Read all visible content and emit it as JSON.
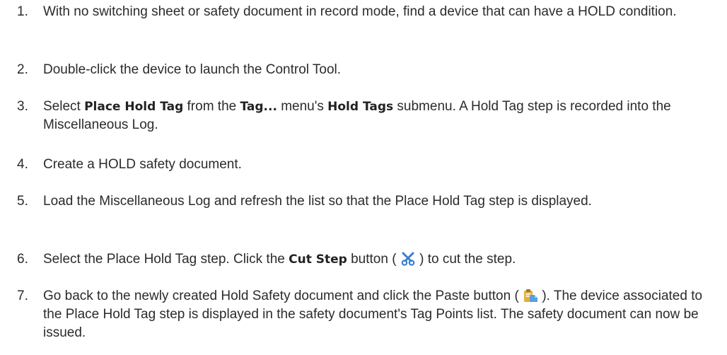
{
  "steps": [
    {
      "number": "1.",
      "text": "With no switching sheet or safety document in record mode, find a device that can have a HOLD condition."
    },
    {
      "number": "2.",
      "text": "Double-click the device to launch the Control Tool."
    },
    {
      "number": "3.",
      "pre": "Select ",
      "ui1": "Place Hold Tag",
      "mid1": " from the ",
      "ui2": "Tag...",
      "mid2": " menu's ",
      "ui3": "Hold Tags",
      "post": " submenu. A Hold Tag step is recorded into the Miscellaneous Log."
    },
    {
      "number": "4.",
      "text": "Create a HOLD safety document."
    },
    {
      "number": "5.",
      "text": "Load the Miscellaneous Log and refresh the list so that the Place Hold Tag step is displayed."
    },
    {
      "number": "6.",
      "pre": "Select the Place Hold Tag step. Click the ",
      "ui1": "Cut Step",
      "mid1": " button ( ",
      "icon": "scissors-icon",
      "post": " ) to cut the step."
    },
    {
      "number": "7.",
      "pre": "Go back to the newly created Hold Safety document and click the Paste button ( ",
      "icon": "paste-icon",
      "post": " ). The device associated to the Place Hold Tag step is displayed in the safety document's Tag Points list. The safety document can now be issued."
    }
  ],
  "colors": {
    "text": "#2b2b2b",
    "scissors": "#3a7fd0",
    "paste_clipboard": "#e2b13c",
    "paste_sheet": "#5aa0e0"
  }
}
